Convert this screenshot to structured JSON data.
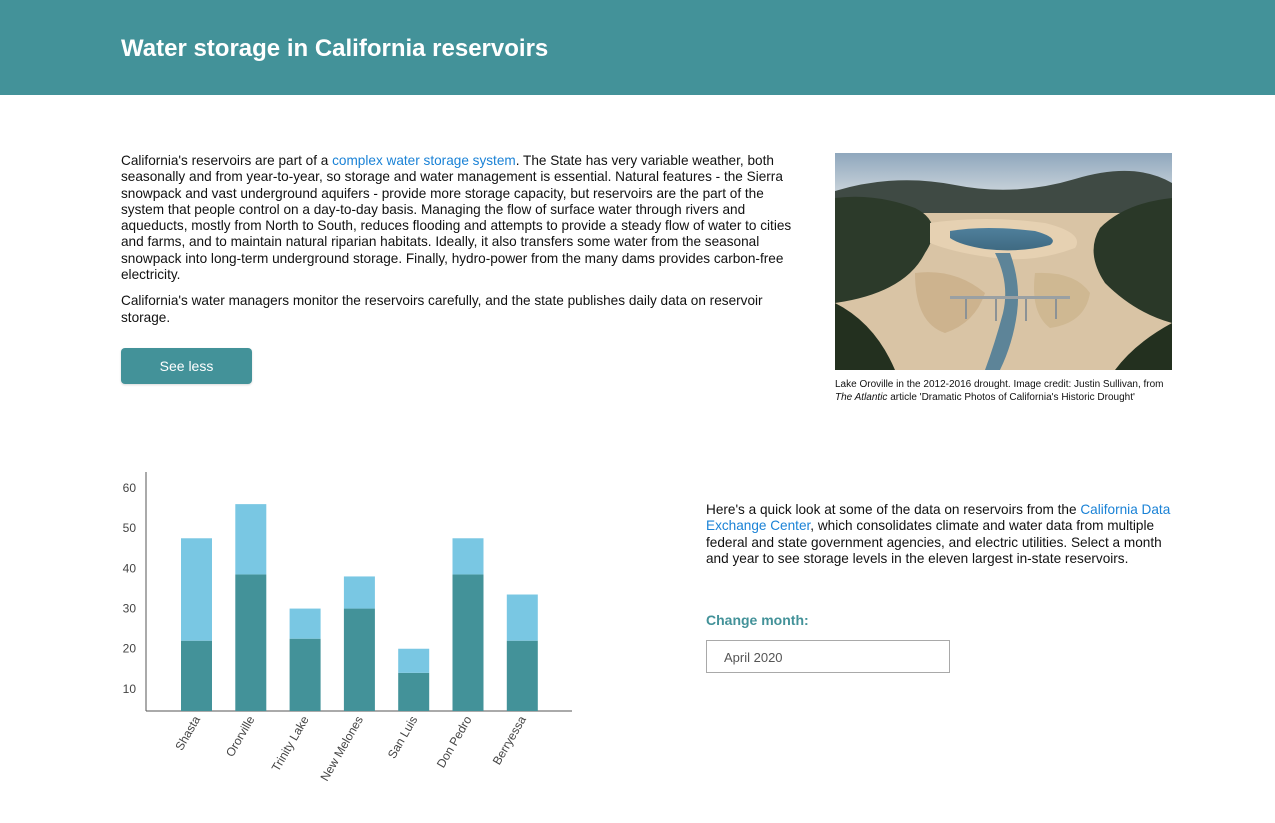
{
  "header": {
    "title": "Water storage in California reservoirs"
  },
  "intro": {
    "p1_before": "California's reservoirs are part of a ",
    "p1_link": "complex water storage system",
    "p1_after": ". The State has very variable weather, both seasonally and from year-to-year, so storage and water management is essential. Natural features - the Sierra snowpack and vast underground aquifers - provide more storage capacity, but reservoirs are the part of the system that people control on a day-to-day basis.  Managing the flow of surface water through rivers and aqueducts, mostly from North to South, reduces flooding and attempts to provide a steady flow of water to cities and farms, and to maintain natural riparian habitats. Ideally, it also transfers some water from the seasonal snowpack into long-term underground storage. Finally, hydro-power from the many dams provides carbon-free electricity.",
    "p2": "California's water managers monitor the reservoirs carefully, and the state publishes daily data on reservoir storage.",
    "toggle_button": "See less"
  },
  "photo": {
    "caption_before": "Lake Oroville in the 2012-2016 drought. Image credit: Justin Sullivan, from ",
    "caption_italic": "The Atlantic",
    "caption_after": " article 'Dramatic Photos of California's Historic Drought'"
  },
  "side": {
    "text_before": "Here's a quick look at some of the data on reservoirs from the ",
    "text_link": "California Data Exchange Center",
    "text_after": ", which consolidates climate and water data from multiple federal and state government agencies, and  electric utilities. Select a month and year to see storage levels in the eleven largest in-state reservoirs.",
    "month_label": "Change month:",
    "month_value": "April 2020"
  },
  "colors": {
    "teal": "#439299",
    "light_blue": "#79c7e3",
    "link": "#1a82d6"
  },
  "chart_data": {
    "type": "bar",
    "stacked": true,
    "categories": [
      "Shasta",
      "Ororville",
      "Trinity Lake",
      "New Melones",
      "San Luis",
      "Don Pedro",
      "Berryessa"
    ],
    "series": [
      {
        "values": [
          22,
          38.5,
          22.5,
          30,
          14,
          38.5,
          22
        ],
        "color": "#439299"
      },
      {
        "values": [
          25.5,
          17.5,
          7.5,
          8,
          6,
          9,
          11.5
        ],
        "color": "#79c7e3"
      }
    ],
    "yticks": [
      10,
      20,
      30,
      40,
      50,
      60
    ],
    "ylim": [
      4.5,
      64
    ],
    "grid": false
  }
}
